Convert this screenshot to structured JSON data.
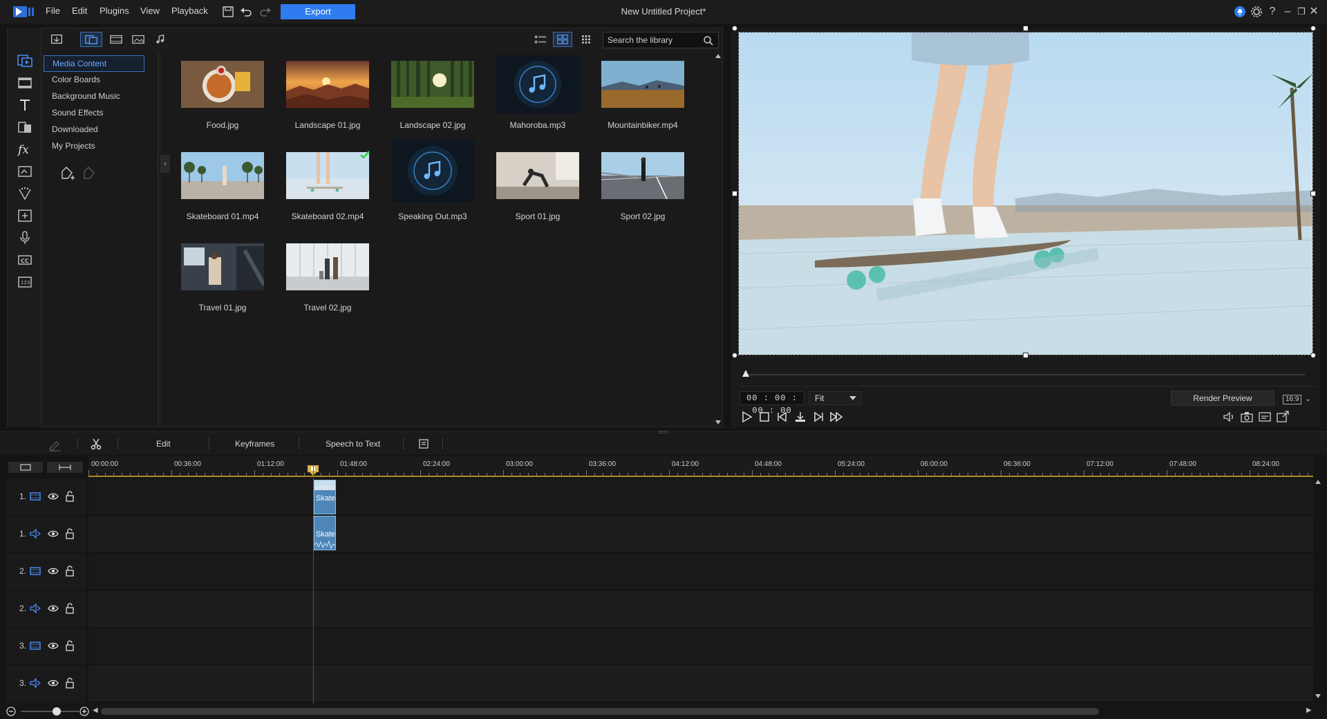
{
  "menubar": {
    "items": [
      "File",
      "Edit",
      "Plugins",
      "View",
      "Playback"
    ],
    "export_label": "Export",
    "window_title": "New Untitled Project*",
    "icons": [
      "save-icon",
      "undo-icon",
      "redo-icon",
      "notification-icon",
      "settings-icon",
      "help-icon",
      "minimize-icon",
      "restore-icon",
      "close-icon"
    ]
  },
  "library": {
    "search_placeholder": "Search the library",
    "categories": [
      "Media Content",
      "Color Boards",
      "Background Music",
      "Sound Effects",
      "Downloaded",
      "My Projects"
    ],
    "active_category": "Media Content",
    "media": [
      {
        "name": "Food.jpg",
        "kind": "image"
      },
      {
        "name": "Landscape 01.jpg",
        "kind": "image"
      },
      {
        "name": "Landscape 02.jpg",
        "kind": "image"
      },
      {
        "name": "Mahoroba.mp3",
        "kind": "audio"
      },
      {
        "name": "Mountainbiker.mp4",
        "kind": "video"
      },
      {
        "name": "Skateboard 01.mp4",
        "kind": "video"
      },
      {
        "name": "Skateboard 02.mp4",
        "kind": "video",
        "in_use": true
      },
      {
        "name": "Speaking Out.mp3",
        "kind": "audio"
      },
      {
        "name": "Sport 01.jpg",
        "kind": "image"
      },
      {
        "name": "Sport 02.jpg",
        "kind": "image"
      },
      {
        "name": "Travel 01.jpg",
        "kind": "image"
      },
      {
        "name": "Travel 02.jpg",
        "kind": "image"
      }
    ]
  },
  "preview": {
    "timecode": "00 : 00 : 00 : 00",
    "fit_label": "Fit",
    "render_label": "Render Preview",
    "aspect_ratio": "16:9"
  },
  "timeline_toolbar": {
    "edit_label": "Edit",
    "keyframes_label": "Keyframes",
    "speech_label": "Speech to Text"
  },
  "timeline": {
    "ruler": [
      "00:00:00",
      "00:36:00",
      "01:12:00",
      "01:48:00",
      "02:24:00",
      "03:00:00",
      "03:36:00",
      "04:12:00",
      "04:48:00",
      "05:24:00",
      "06:00:00",
      "06:36:00",
      "07:12:00",
      "07:48:00",
      "08:24:00"
    ],
    "tracks": [
      {
        "num": "1.",
        "type": "video"
      },
      {
        "num": "1.",
        "type": "audio"
      },
      {
        "num": "2.",
        "type": "video"
      },
      {
        "num": "2.",
        "type": "audio"
      },
      {
        "num": "3.",
        "type": "video"
      },
      {
        "num": "3.",
        "type": "audio"
      }
    ],
    "clip_label": "Skate"
  },
  "colors": {
    "accent": "#2f7cf0",
    "playhead": "#e11111",
    "clip": "#4f86b8",
    "ruler_marker": "#b08a2a"
  }
}
